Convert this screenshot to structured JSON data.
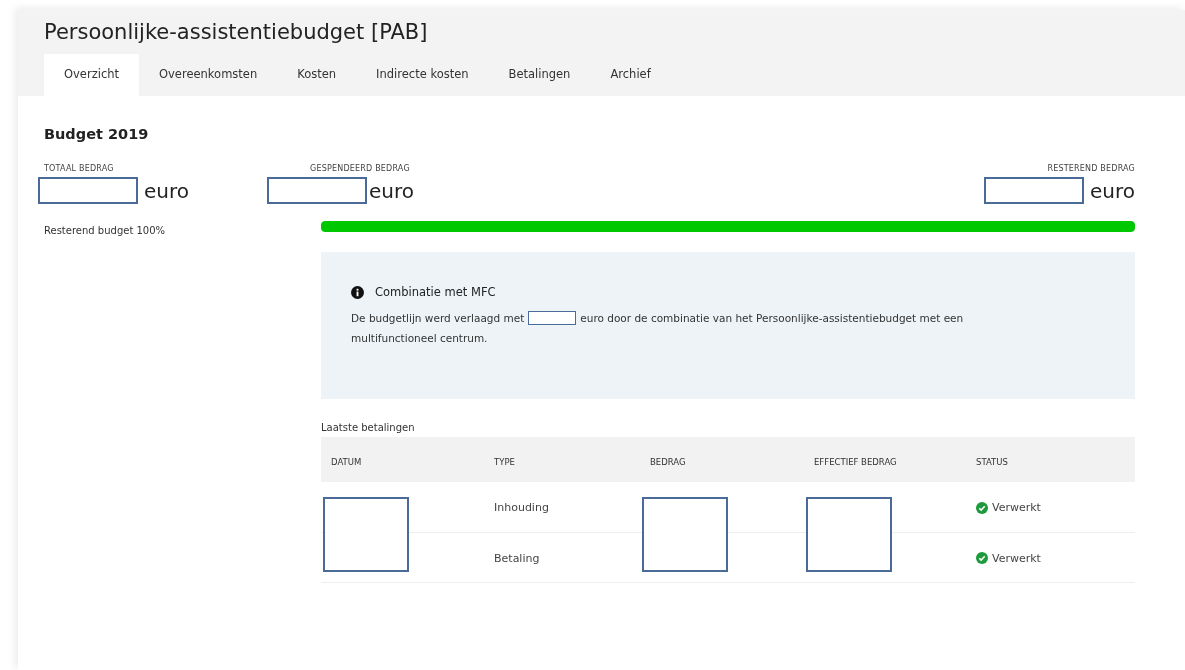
{
  "page": {
    "title": "Persoonlijke-assistentiebudget [PAB]"
  },
  "tabs": [
    {
      "label": "Overzicht",
      "selected": true
    },
    {
      "label": "Overeenkomsten",
      "selected": false
    },
    {
      "label": "Kosten",
      "selected": false
    },
    {
      "label": "Indirecte kosten",
      "selected": false
    },
    {
      "label": "Betalingen",
      "selected": false
    },
    {
      "label": "Archief",
      "selected": false
    }
  ],
  "budget": {
    "heading": "Budget 2019",
    "amounts": [
      {
        "label": "TOTAAL BEDRAG",
        "unit": "euro"
      },
      {
        "label": "GESPENDEERD BEDRAG",
        "unit": "euro"
      },
      {
        "label": "RESTEREND BEDRAG",
        "unit": "euro"
      }
    ],
    "remaining_label": "Resterend budget 100%",
    "level": 1
  },
  "notice": {
    "title": "Combinatie met MFC",
    "text_before": "De budgetlijn werd verlaagd met",
    "text_after": "euro door de combinatie van het Persoonlijke-assistentiebudget met een",
    "text_continued": "multifunctioneel centrum."
  },
  "payments": {
    "caption": "Laatste betalingen",
    "columns": [
      "DATUM",
      "TYPE",
      "BEDRAG",
      "EFFECTIEF BEDRAG",
      "STATUS"
    ],
    "rows": [
      {
        "type": "Inhouding",
        "status": "Verwerkt"
      },
      {
        "type": "Betaling",
        "status": "Verwerkt"
      }
    ]
  }
}
